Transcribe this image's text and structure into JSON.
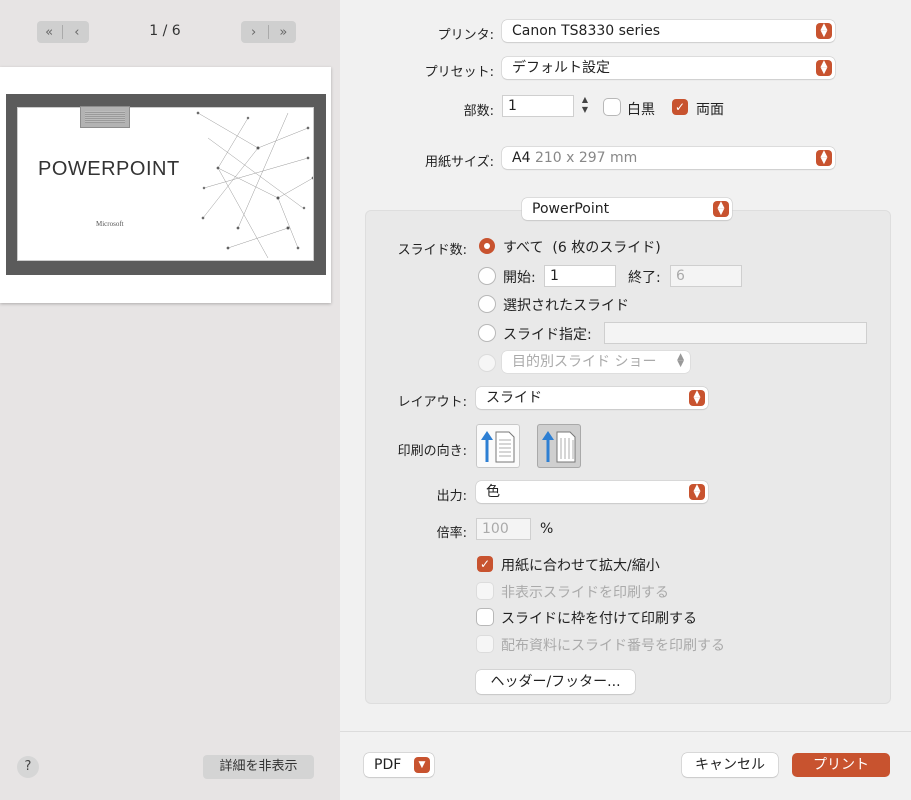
{
  "nav": {
    "first_icon": "«",
    "prev_icon": "‹",
    "next_icon": "›",
    "last_icon": "»",
    "page_count": "1 / 6"
  },
  "preview": {
    "title": "POWERPOINT",
    "subtitle": "Microsoft"
  },
  "footer_left": {
    "help_label": "?",
    "hide_details_label": "詳細を非表示"
  },
  "printer": {
    "label": "プリンタ:",
    "value": "Canon TS8330 series"
  },
  "preset": {
    "label": "プリセット:",
    "value": "デフォルト設定"
  },
  "copies": {
    "label": "部数:",
    "value": "1",
    "bw_label": "白黒",
    "bw_checked": false,
    "duplex_label": "両面",
    "duplex_checked": true
  },
  "paper": {
    "label": "用紙サイズ:",
    "value": "A4",
    "dims": "210 x 297 mm"
  },
  "app_menu": {
    "value": "PowerPoint"
  },
  "slides": {
    "label": "スライド数:",
    "all_label": "すべて",
    "all_count": "(6 枚のスライド)",
    "start_label": "開始:",
    "start_value": "1",
    "end_label": "終了:",
    "end_value": "6",
    "selected_label": "選択されたスライド",
    "custom_label": "スライド指定:",
    "custom_value": "",
    "custom_show_label": "目的別スライド ショー"
  },
  "layout": {
    "label": "レイアウト:",
    "value": "スライド"
  },
  "orientation": {
    "label": "印刷の向き:"
  },
  "output": {
    "label": "出力:",
    "value": "色"
  },
  "scale": {
    "label": "倍率:",
    "value": "100",
    "unit": "%"
  },
  "options": {
    "fit_label": "用紙に合わせて拡大/縮小",
    "hidden_label": "非表示スライドを印刷する",
    "frame_label": "スライドに枠を付けて印刷する",
    "number_label": "配布資料にスライド番号を印刷する"
  },
  "header_footer_label": "ヘッダー/フッター...",
  "bottom": {
    "pdf_label": "PDF",
    "cancel_label": "キャンセル",
    "print_label": "プリント"
  },
  "colors": {
    "accent": "#c8532f"
  }
}
